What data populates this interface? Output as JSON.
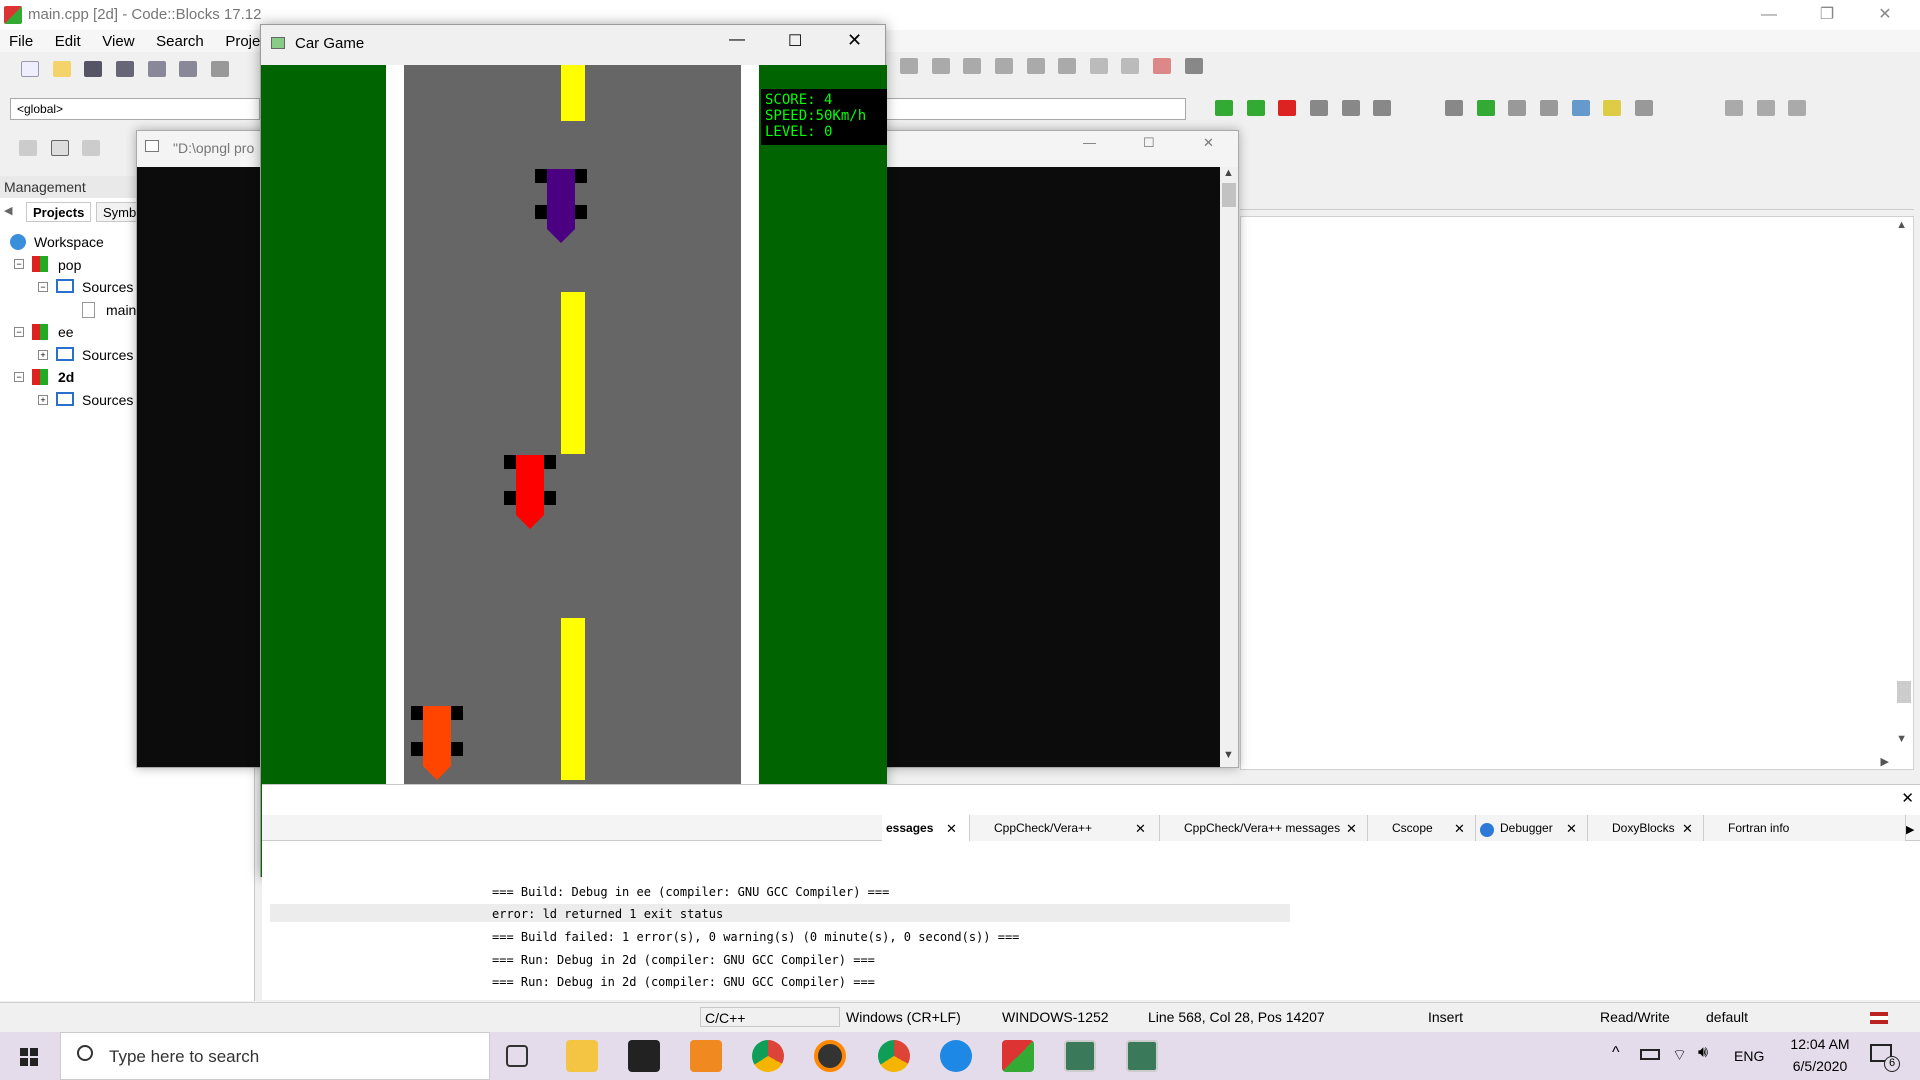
{
  "window": {
    "title": "main.cpp [2d] - Code::Blocks 17.12",
    "controls": {
      "minimize": "—",
      "restore": "❐",
      "close": "✕"
    }
  },
  "menu": [
    "File",
    "Edit",
    "View",
    "Search",
    "Project"
  ],
  "toolbar": {
    "scope_combo": "<global>"
  },
  "management": {
    "header": "Management",
    "tabs": [
      "Projects",
      "Symb"
    ],
    "tree": [
      {
        "label": "Workspace"
      },
      {
        "label": "pop"
      },
      {
        "label": "Sources"
      },
      {
        "label": "main"
      },
      {
        "label": "ee"
      },
      {
        "label": "Sources"
      },
      {
        "label": "2d"
      },
      {
        "label": "Sources"
      }
    ]
  },
  "console_window": {
    "title": "\"D:\\opngl pro"
  },
  "game_window": {
    "title": "Car Game",
    "hud": {
      "score": "SCORE: 4",
      "speed": "SPEED:50Km/h",
      "level": "LEVEL: 0"
    },
    "colors": {
      "grass": "#006400",
      "road": "#666666",
      "divider": "#ffff00",
      "player": "#2db36b",
      "enemy_purple": "#4b0082",
      "enemy_red": "#ff0000",
      "enemy_orange": "#ff4500"
    }
  },
  "logs": {
    "tabs": [
      "essages",
      "CppCheck/Vera++",
      "CppCheck/Vera++ messages",
      "Cscope",
      "Debugger",
      "DoxyBlocks",
      "Fortran info"
    ],
    "lines": [
      "=== Build: Debug in ee (compiler: GNU GCC Compiler) ===",
      "error: ld returned 1 exit status",
      "=== Build failed: 1 error(s), 0 warning(s) (0 minute(s), 0 second(s)) ===",
      "=== Run: Debug in 2d (compiler: GNU GCC Compiler) ===",
      "=== Run: Debug in 2d (compiler: GNU GCC Compiler) ==="
    ]
  },
  "statusbar": {
    "language": "C/C++",
    "line_endings": "Windows (CR+LF)",
    "encoding": "WINDOWS-1252",
    "position": "Line 568, Col 28, Pos 14207",
    "mode": "Insert",
    "access": "Read/Write",
    "profile": "default"
  },
  "taskbar": {
    "search_placeholder": "Type here to search",
    "tray": {
      "lang": "ENG",
      "time": "12:04 AM",
      "date": "6/5/2020",
      "notifications": "6"
    }
  }
}
